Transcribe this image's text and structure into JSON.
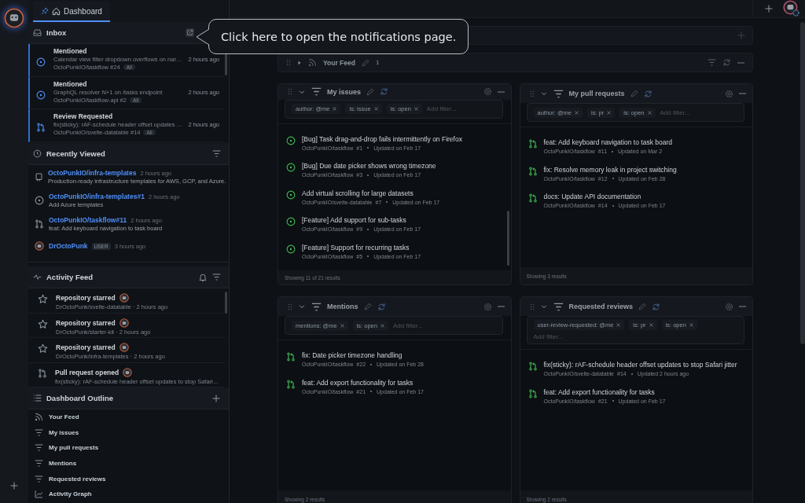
{
  "tab": {
    "label": "Dashboard",
    "selected": true
  },
  "tooltip": "Click here to open the notifications page.",
  "inbox": {
    "title": "Inbox",
    "items": [
      {
        "kind": "issue",
        "unread": true,
        "title": "Mentioned",
        "text": "Calendar view filter dropdown overflows on nar…",
        "repo": "OctoPunkIO/taskflow #24",
        "tag": "All",
        "time": "2 hours ago"
      },
      {
        "kind": "issue",
        "unread": true,
        "title": "Mentioned",
        "text": "GraphQL resolver N+1 on /tasks endpoint",
        "repo": "OctoPunkIO/taskflow-api #2",
        "tag": "All",
        "time": "2 hours ago"
      },
      {
        "kind": "pr",
        "unread": true,
        "title": "Review Requested",
        "text": "fix(sticky): rAF-schedule header offset updates …",
        "repo": "OctoPunkIO/svelte-datatable #14",
        "tag": "All",
        "time": "2 hours ago"
      }
    ]
  },
  "recently_viewed": {
    "title": "Recently Viewed",
    "items": [
      {
        "kind": "repo",
        "name": "OctoPunkIO/infra-templates",
        "time": "2 hours ago",
        "text": "Production-ready infrastructure templates for AWS, GCP, and Azure."
      },
      {
        "kind": "issue",
        "name": "OctoPunkIO/infra-templates#1",
        "time": "2 hours ago",
        "text": "Add Azure templates"
      },
      {
        "kind": "pr",
        "name": "OctoPunkIO/taskflow#11",
        "time": "2 hours ago",
        "text": "feat: Add keyboard navigation to task board"
      },
      {
        "kind": "user",
        "name": "DrOctoPunk",
        "badge": "USER",
        "time": "3 hours ago"
      }
    ]
  },
  "activity_feed": {
    "title": "Activity Feed",
    "items": [
      {
        "kind": "star",
        "title": "Repository starred",
        "text": "DrOctoPunk/svelte-datatable · 2 hours ago"
      },
      {
        "kind": "star",
        "title": "Repository starred",
        "text": "DrOctoPunk/starter-kit · 2 hours ago"
      },
      {
        "kind": "star",
        "title": "Repository starred",
        "text": "DrOctoPunk/infra-templates · 2 hours ago"
      },
      {
        "kind": "pr",
        "title": "Pull request opened",
        "text": "fix(sticky): rAF-schedule header offset updates to stop Safari…"
      }
    ]
  },
  "outline": {
    "title": "Dashboard Outline",
    "items": [
      {
        "kind": "feed",
        "label": "Your Feed"
      },
      {
        "kind": "filter",
        "label": "My issues"
      },
      {
        "kind": "filter",
        "label": "My pull requests"
      },
      {
        "kind": "filter",
        "label": "Mentions"
      },
      {
        "kind": "filter",
        "label": "Requested reviews"
      },
      {
        "kind": "graph",
        "label": "Activity Graph"
      }
    ]
  },
  "your_feed": {
    "title": "Your Feed",
    "count": "1"
  },
  "panels": [
    {
      "title": "My issues",
      "filters": [
        "author: @me",
        "is: issue",
        "is: open"
      ],
      "placeholder": "Add filter...",
      "footer": "Showing 11 of 21 results",
      "items": [
        {
          "kind": "issue",
          "title": "[Bug] Task drag-and-drop fails intermittently on Firefox",
          "repo": "OctoPunkIO/taskflow",
          "number": "#1",
          "updated": "Updated on Feb 17"
        },
        {
          "kind": "issue",
          "title": "[Bug] Due date picker shows wrong timezone",
          "repo": "OctoPunkIO/taskflow",
          "number": "#3",
          "updated": "Updated on Feb 17"
        },
        {
          "kind": "issue",
          "title": "Add virtual scrolling for large datasets",
          "repo": "OctoPunkIO/svelte-datatable",
          "number": "#7",
          "updated": "Updated on Feb 17"
        },
        {
          "kind": "issue",
          "title": "[Feature] Add support for sub-tasks",
          "repo": "OctoPunkIO/taskflow",
          "number": "#9",
          "updated": "Updated on Feb 17"
        },
        {
          "kind": "issue",
          "title": "[Feature] Support for recurring tasks",
          "repo": "OctoPunkIO/taskflow",
          "number": "#5",
          "updated": "Updated on Feb 17"
        }
      ]
    },
    {
      "title": "My pull requests",
      "filters": [
        "author: @me",
        "is: pr",
        "is: open"
      ],
      "placeholder": "Add filter...",
      "footer": "Showing 3 results",
      "items": [
        {
          "kind": "pr",
          "title": "feat: Add keyboard navigation to task board",
          "repo": "OctoPunkIO/taskflow",
          "number": "#11",
          "updated": "Updated on Mar 2"
        },
        {
          "kind": "pr",
          "title": "fix: Resolve memory leak in project switching",
          "repo": "OctoPunkIO/taskflow",
          "number": "#12",
          "updated": "Updated on Feb 28"
        },
        {
          "kind": "pr",
          "title": "docs: Update API documentation",
          "repo": "OctoPunkIO/taskflow",
          "number": "#14",
          "updated": "Updated on Feb 17"
        }
      ]
    },
    {
      "title": "Mentions",
      "filters": [
        "mentions: @me",
        "is: open"
      ],
      "placeholder": "Add filter...",
      "footer": "Showing 2 results",
      "items": [
        {
          "kind": "pr",
          "title": "fix: Date picker timezone handling",
          "repo": "OctoPunkIO/taskflow",
          "number": "#22",
          "updated": "Updated on Feb 28"
        },
        {
          "kind": "pr",
          "title": "feat: Add export functionality for tasks",
          "repo": "OctoPunkIO/taskflow",
          "number": "#21",
          "updated": "Updated on Feb 17"
        }
      ]
    },
    {
      "title": "Requested reviews",
      "filters": [
        "user-review-requested: @me",
        "is: pr",
        "is: open"
      ],
      "placeholder": "Add filter...",
      "footer": "Showing 2 results",
      "items": [
        {
          "kind": "pr",
          "title": "fix(sticky): rAF-schedule header offset updates to stop Safari jitter",
          "repo": "OctoPunkIO/svelte-datatable",
          "number": "#14",
          "updated": "Updated 2 hours ago"
        },
        {
          "kind": "pr",
          "title": "feat: Add export functionality for tasks",
          "repo": "OctoPunkIO/taskflow",
          "number": "#21",
          "updated": "Updated on Feb 17"
        }
      ]
    }
  ]
}
